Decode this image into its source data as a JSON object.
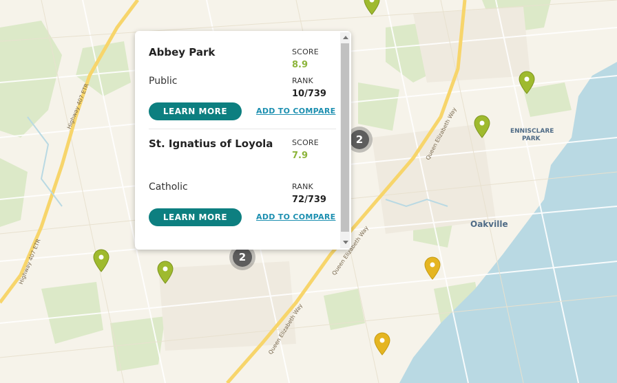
{
  "map": {
    "place_labels": [
      {
        "id": "oakville",
        "text": "Oakville"
      },
      {
        "id": "ennisclare-1",
        "text": "ENNISCLARE"
      },
      {
        "id": "ennisclare-2",
        "text": "PARK"
      }
    ],
    "road_labels": [
      {
        "id": "hwy407-top",
        "text": "Highway 407 ETR"
      },
      {
        "id": "hwy407-bottom",
        "text": "Highway 407 ETR"
      },
      {
        "id": "qew-top",
        "text": "Queen Elizabeth Way"
      },
      {
        "id": "qew-mid",
        "text": "Queen Elizabeth Way"
      },
      {
        "id": "qew-bottom",
        "text": "Queen Elizabeth Way"
      }
    ],
    "clusters": [
      {
        "id": "cluster-1",
        "count": "2"
      },
      {
        "id": "cluster-2",
        "count": "2"
      }
    ],
    "colors": {
      "land": "#f6f3ea",
      "park": "#dce9c8",
      "water": "#b9d9e3",
      "highway": "#f7d56b",
      "pin_green": "#9fba2e",
      "pin_yellow": "#e5b521"
    }
  },
  "popup": {
    "schools": [
      {
        "name": "Abbey Park",
        "type": "Public",
        "score_label": "SCORE",
        "score": "8.9",
        "rank_label": "RANK",
        "rank": "10/739",
        "learn_more": "LEARN MORE",
        "compare": "ADD TO COMPARE"
      },
      {
        "name": "St. Ignatius of Loyola",
        "type": "Catholic",
        "score_label": "SCORE",
        "score": "7.9",
        "rank_label": "RANK",
        "rank": "72/739",
        "learn_more": "LEARN MORE",
        "compare": "ADD TO COMPARE"
      }
    ]
  }
}
